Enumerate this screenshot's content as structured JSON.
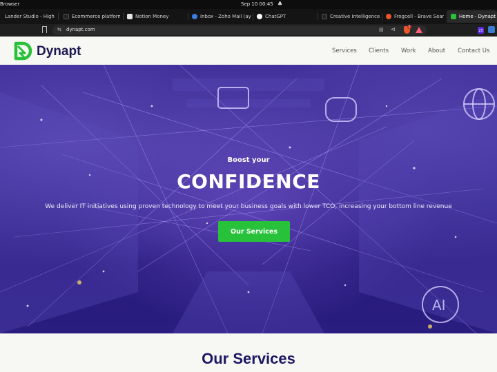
{
  "os": {
    "app_name": "Browser",
    "clock": "Sep 10  00:45",
    "bell_icon": "bell-icon"
  },
  "browser": {
    "tabs": [
      {
        "label": "Lander Studio - High",
        "color": "#7a7a7a",
        "active": false
      },
      {
        "label": "Ecommerce platform",
        "color": "#222222",
        "active": false
      },
      {
        "label": "Notion Money",
        "color": "#e6e6e6",
        "active": false
      },
      {
        "label": "Inbox - Zoho Mail (ay",
        "color": "#3d7be0",
        "active": false
      },
      {
        "label": "ChatGPT",
        "color": "#ffffff",
        "active": false
      },
      {
        "label": "Creative Intelligence",
        "color": "#222222",
        "active": false
      },
      {
        "label": "Frogcell - Brave Sear",
        "color": "#e8562a",
        "active": false
      },
      {
        "label": "Home - Dynapt",
        "color": "#27c23a",
        "active": true
      }
    ],
    "url": "dynapt.com",
    "shield_badge": "5",
    "ext_badge": "25"
  },
  "site": {
    "logo_text": "Dynapt",
    "brand_color": "#27c23a",
    "nav": [
      {
        "label": "Services"
      },
      {
        "label": "Clients"
      },
      {
        "label": "Work"
      },
      {
        "label": "About"
      },
      {
        "label": "Contact Us"
      }
    ],
    "hero": {
      "eyebrow": "Boost your",
      "title": "CONFIDENCE",
      "subtitle": "We deliver IT initiatives using proven technology to meet your business goals with lower TCO, increasing your bottom line revenue",
      "cta": "Our Services",
      "ai_badge": "AI"
    },
    "services_heading": "Our Services"
  }
}
